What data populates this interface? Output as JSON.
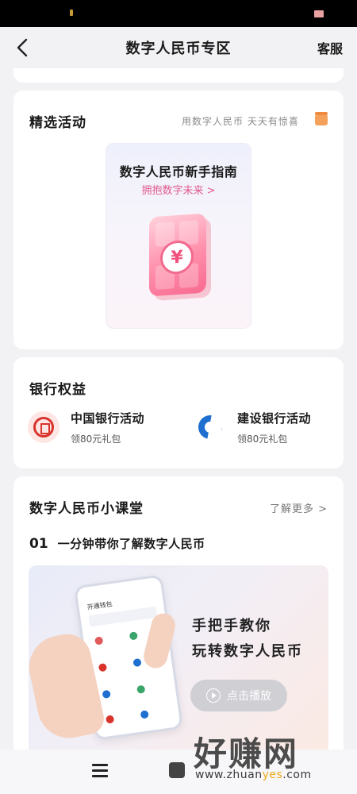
{
  "header": {
    "title": "数字人民币专区",
    "service_label": "客服"
  },
  "featured": {
    "title": "精选活动",
    "hint": "用数字人民币 天天有惊喜",
    "guide": {
      "title": "数字人民币新手指南",
      "subtitle": "拥抱数字未来 >",
      "coin_symbol": "¥"
    }
  },
  "banks": {
    "title": "银行权益",
    "items": [
      {
        "name": "中国银行活动",
        "gift": "领80元礼包",
        "brand_color": "#d8342c"
      },
      {
        "name": "建设银行活动",
        "gift": "领80元礼包",
        "brand_color": "#1f6fd0"
      }
    ]
  },
  "classroom": {
    "title": "数字人民币小课堂",
    "more_label": "了解更多 >",
    "lesson": {
      "number": "01",
      "title": "一分钟带你了解数字人民币"
    },
    "banner": {
      "line1": "手把手教你",
      "line2": "玩转数字人民币",
      "play_label": "点击播放",
      "phone_label": "开通钱包"
    }
  },
  "watermark": {
    "main": "好赚网",
    "url_prefix": "www.zhuan",
    "url_accent": "yes",
    "url_suffix": ".com"
  },
  "colors": {
    "accent_pink": "#e05a8c",
    "background": "#f2f2f4"
  }
}
